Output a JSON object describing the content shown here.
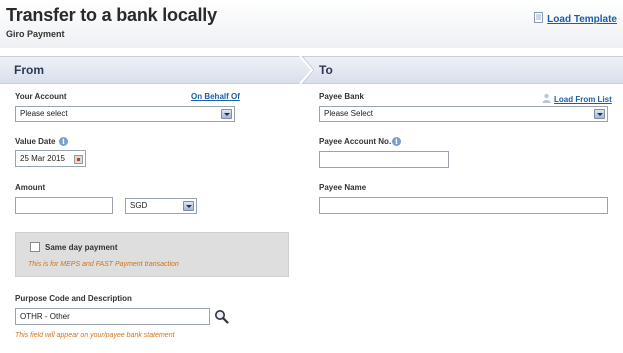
{
  "header": {
    "title": "Transfer to a bank locally",
    "subtitle": "Giro Payment",
    "load_template_label": "Load Template",
    "load_template_icon": "document-icon"
  },
  "sections": {
    "from_label": "From",
    "to_label": "To"
  },
  "from": {
    "your_account": {
      "label": "Your Account",
      "on_behalf_link": "On Behalf Of",
      "selected": "Please select"
    },
    "value_date": {
      "label": "Value Date",
      "value": "25 Mar 2015"
    },
    "amount": {
      "label": "Amount",
      "value": "",
      "currency": "SGD"
    },
    "same_day": {
      "label": "Same day payment",
      "note": "This is for MEPS and FAST Payment transaction",
      "checked": false
    },
    "purpose": {
      "label": "Purpose Code and Description",
      "value": "OTHR - Other",
      "note": "This field will appear on your/payee bank statement"
    }
  },
  "to": {
    "payee_bank": {
      "label": "Payee Bank",
      "load_from_list": "Load From List",
      "selected": "Please Select"
    },
    "payee_account": {
      "label": "Payee Account No.",
      "value": ""
    },
    "payee_name": {
      "label": "Payee Name",
      "value": ""
    }
  },
  "colors": {
    "link": "#1a5ea8",
    "note": "#d0731b",
    "section_text": "#2b3a52"
  }
}
